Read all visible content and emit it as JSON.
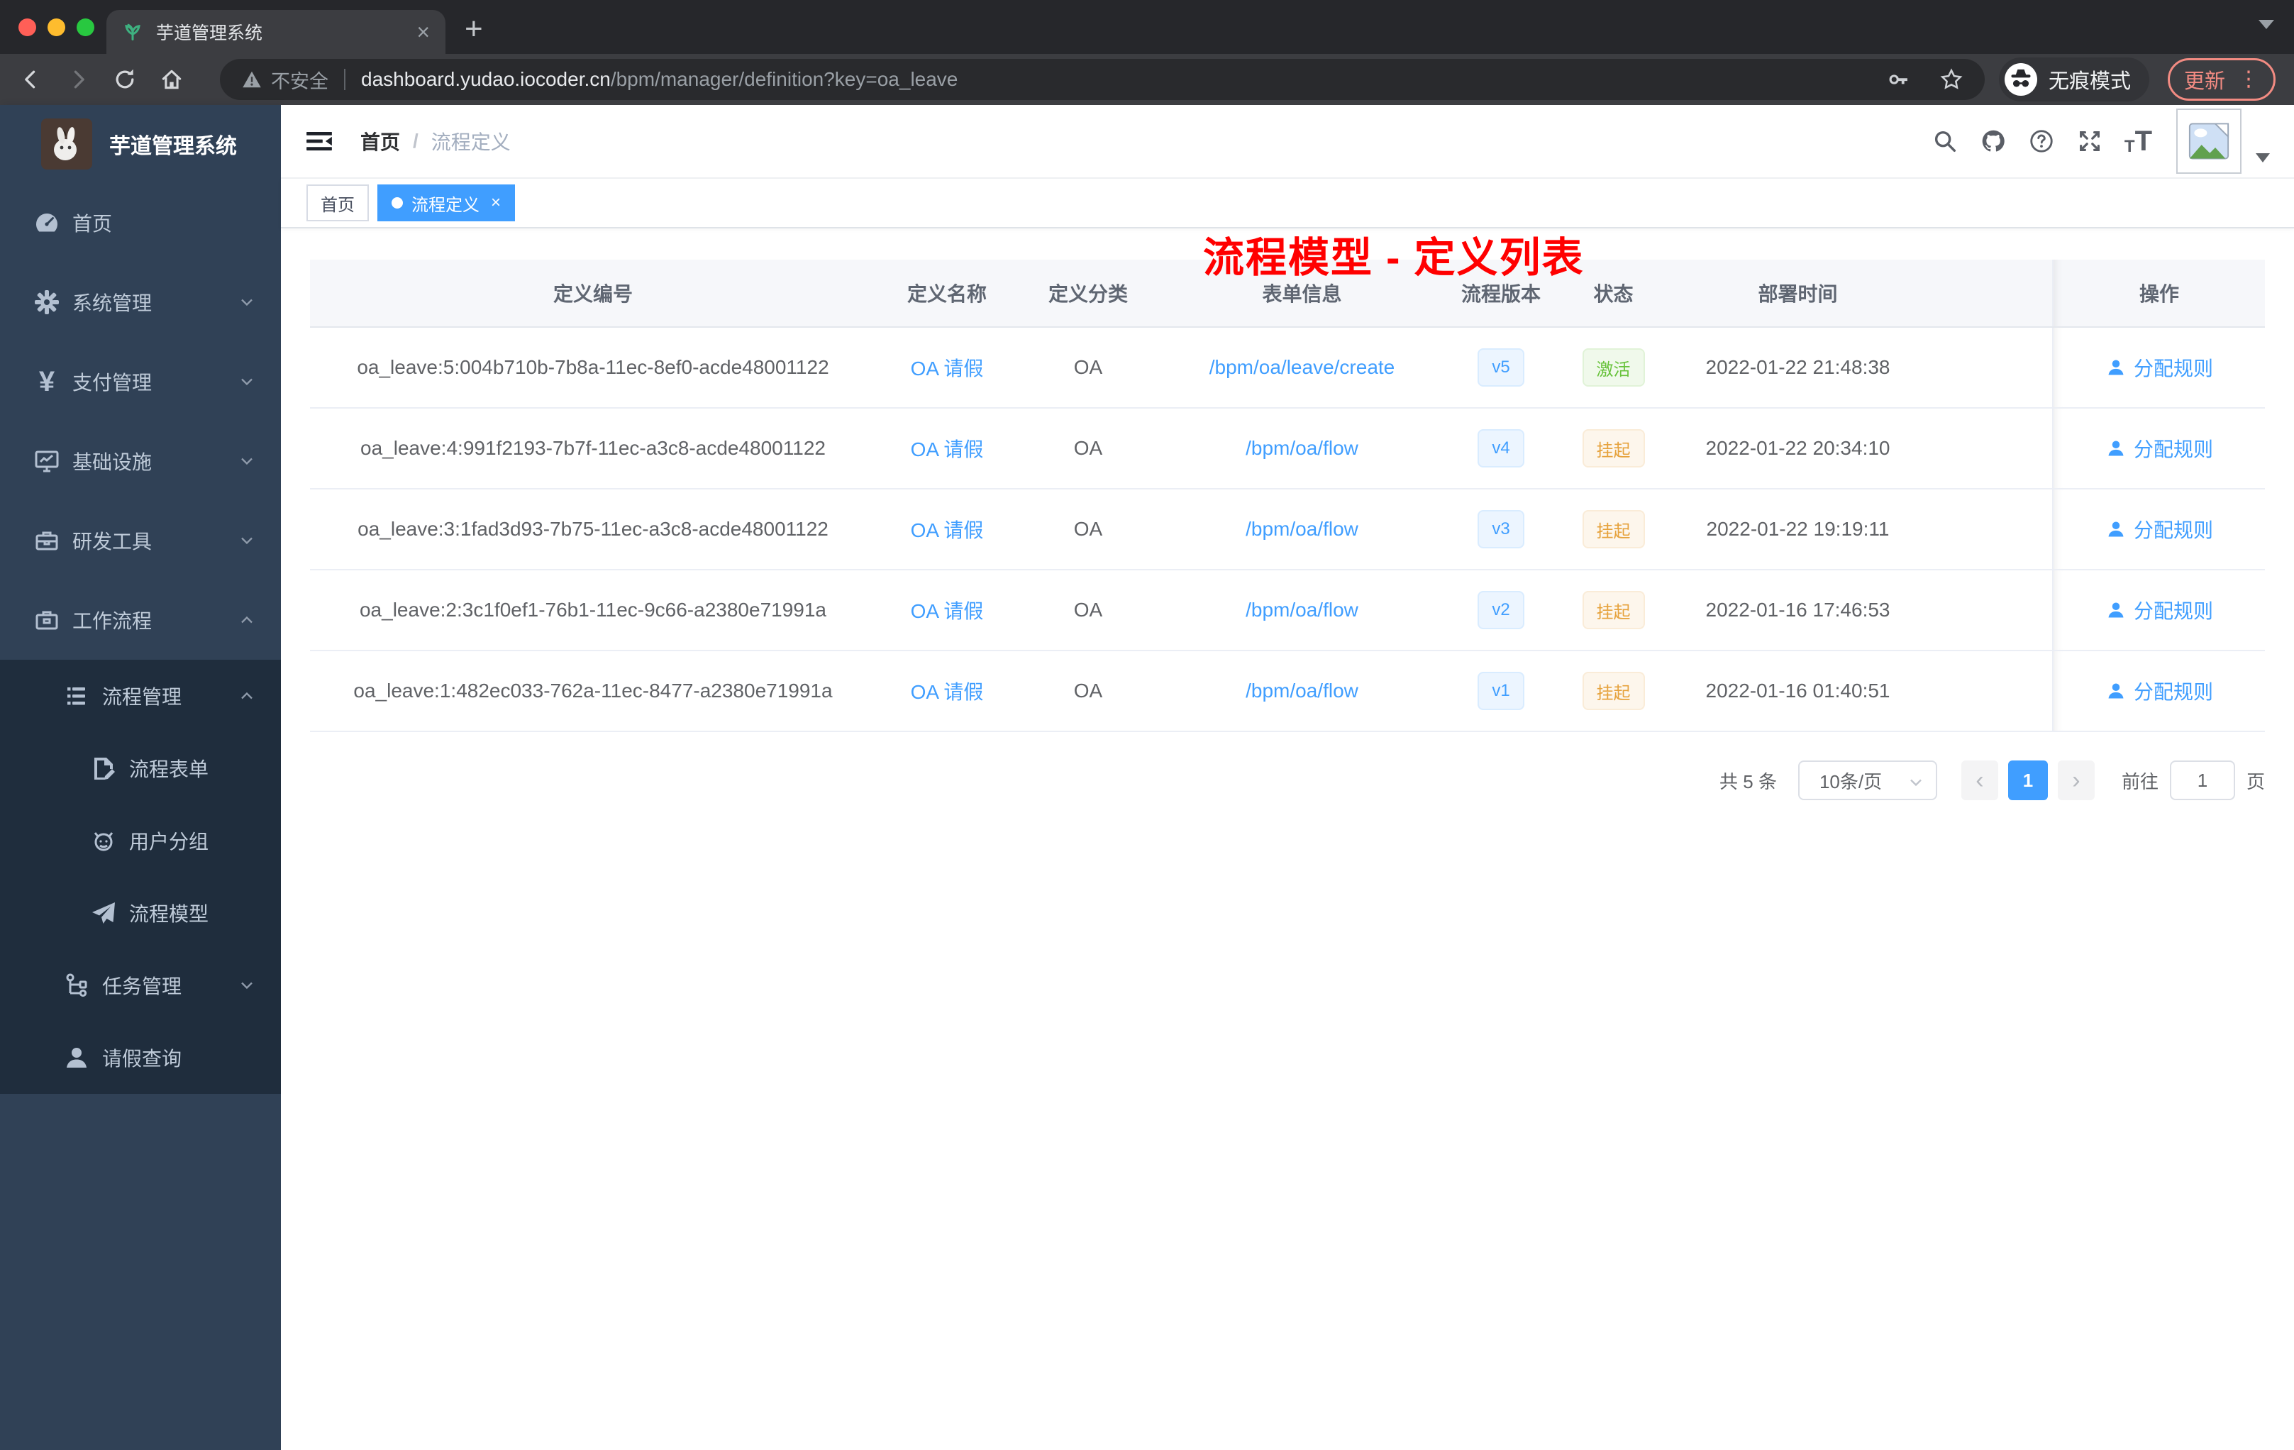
{
  "browser": {
    "tab": {
      "title": "芋道管理系统",
      "close_glyph": "×",
      "newtab_glyph": "+"
    },
    "address": {
      "security": "不安全",
      "domain": "dashboard.yudao.iocoder.cn",
      "path": "/bpm/manager/definition?key=oa_leave"
    },
    "incognito_label": "无痕模式",
    "update_label": "更新",
    "update_dots": "⋮"
  },
  "sidebar": {
    "logo_title": "芋道管理系统",
    "items": [
      {
        "label": "首页",
        "icon": "dashboard-icon"
      },
      {
        "label": "系统管理",
        "icon": "gear-icon",
        "chevron": "down"
      },
      {
        "label": "支付管理",
        "icon": "money-icon",
        "chevron": "down"
      },
      {
        "label": "基础设施",
        "icon": "monitor-icon",
        "chevron": "down"
      },
      {
        "label": "研发工具",
        "icon": "toolbox-icon",
        "chevron": "down"
      },
      {
        "label": "工作流程",
        "icon": "briefcase-icon",
        "chevron": "up"
      },
      {
        "label": "流程管理",
        "icon": "list-icon",
        "chevron": "up"
      },
      {
        "label": "流程表单",
        "icon": "form-icon"
      },
      {
        "label": "用户分组",
        "icon": "robot-icon"
      },
      {
        "label": "流程模型",
        "icon": "send-icon"
      },
      {
        "label": "任务管理",
        "icon": "tree-icon",
        "chevron": "down"
      },
      {
        "label": "请假查询",
        "icon": "user-icon"
      }
    ]
  },
  "header": {
    "breadcrumb": {
      "home": "首页",
      "separator": "/",
      "current": "流程定义"
    }
  },
  "annotation": {
    "text": "流程模型 - 定义列表",
    "color": "#ff0000"
  },
  "tags": [
    {
      "label": "首页",
      "active": false
    },
    {
      "label": "流程定义",
      "active": true,
      "close_glyph": "×"
    }
  ],
  "table": {
    "headers": [
      "定义编号",
      "定义名称",
      "定义分类",
      "表单信息",
      "流程版本",
      "状态",
      "部署时间",
      "操作"
    ],
    "rows": [
      {
        "id": "oa_leave:5:004b710b-7b8a-11ec-8ef0-acde48001122",
        "name": "OA 请假",
        "category": "OA",
        "form": "/bpm/oa/leave/create",
        "version": "v5",
        "status": "激活",
        "time": "2022-01-22 21:48:38",
        "action": "分配规则"
      },
      {
        "id": "oa_leave:4:991f2193-7b7f-11ec-a3c8-acde48001122",
        "name": "OA 请假",
        "category": "OA",
        "form": "/bpm/oa/flow",
        "version": "v4",
        "status": "挂起",
        "time": "2022-01-22 20:34:10",
        "action": "分配规则"
      },
      {
        "id": "oa_leave:3:1fad3d93-7b75-11ec-a3c8-acde48001122",
        "name": "OA 请假",
        "category": "OA",
        "form": "/bpm/oa/flow",
        "version": "v3",
        "status": "挂起",
        "time": "2022-01-22 19:19:11",
        "action": "分配规则"
      },
      {
        "id": "oa_leave:2:3c1f0ef1-76b1-11ec-9c66-a2380e71991a",
        "name": "OA 请假",
        "category": "OA",
        "form": "/bpm/oa/flow",
        "version": "v2",
        "status": "挂起",
        "time": "2022-01-16 17:46:53",
        "action": "分配规则"
      },
      {
        "id": "oa_leave:1:482ec033-762a-11ec-8477-a2380e71991a",
        "name": "OA 请假",
        "category": "OA",
        "form": "/bpm/oa/flow",
        "version": "v1",
        "status": "挂起",
        "time": "2022-01-16 01:40:51",
        "action": "分配规则"
      }
    ]
  },
  "pagination": {
    "total": "共 5 条",
    "page_size": "10条/页",
    "prev_glyph": "‹",
    "current_page": "1",
    "next_glyph": "›",
    "goto_label": "前往",
    "goto_value": "1",
    "unit_label": "页"
  },
  "colors": {
    "accent": "#409eff",
    "success": "#67c23a",
    "warning": "#e6a23c",
    "annotation_red": "#ff0000",
    "sidebar_bg": "#304156",
    "submenu_bg": "#1f2d3d",
    "update_pill": "#f28b82"
  }
}
